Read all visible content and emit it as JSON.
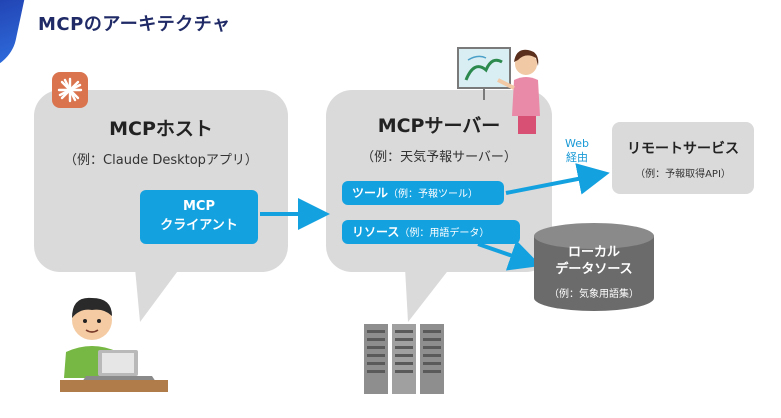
{
  "title": "MCPのアーキテクチャ",
  "host": {
    "title": "MCPホスト",
    "example": "（例：Claude Desktopアプリ）"
  },
  "client": {
    "line1": "MCP",
    "line2": "クライアント"
  },
  "server": {
    "title": "MCPサーバー",
    "example": "（例：天気予報サーバー）"
  },
  "tool": {
    "label": "ツール",
    "example": "（例：予報ツール）"
  },
  "resource": {
    "label": "リソース",
    "example": "（例：用語データ）"
  },
  "web": {
    "line1": "Web",
    "line2": "経由"
  },
  "remote": {
    "title": "リモートサービス",
    "example": "（例：予報取得API）"
  },
  "local": {
    "line1": "ローカル",
    "line2": "データソース",
    "example": "（例：気象用語集）"
  },
  "colors": {
    "accent_blue": "#14a1e0",
    "bubble_gray": "#dadada",
    "db_gray": "#6b6b6b",
    "title_navy": "#1f2a66",
    "claude_orange": "#d9744f"
  }
}
